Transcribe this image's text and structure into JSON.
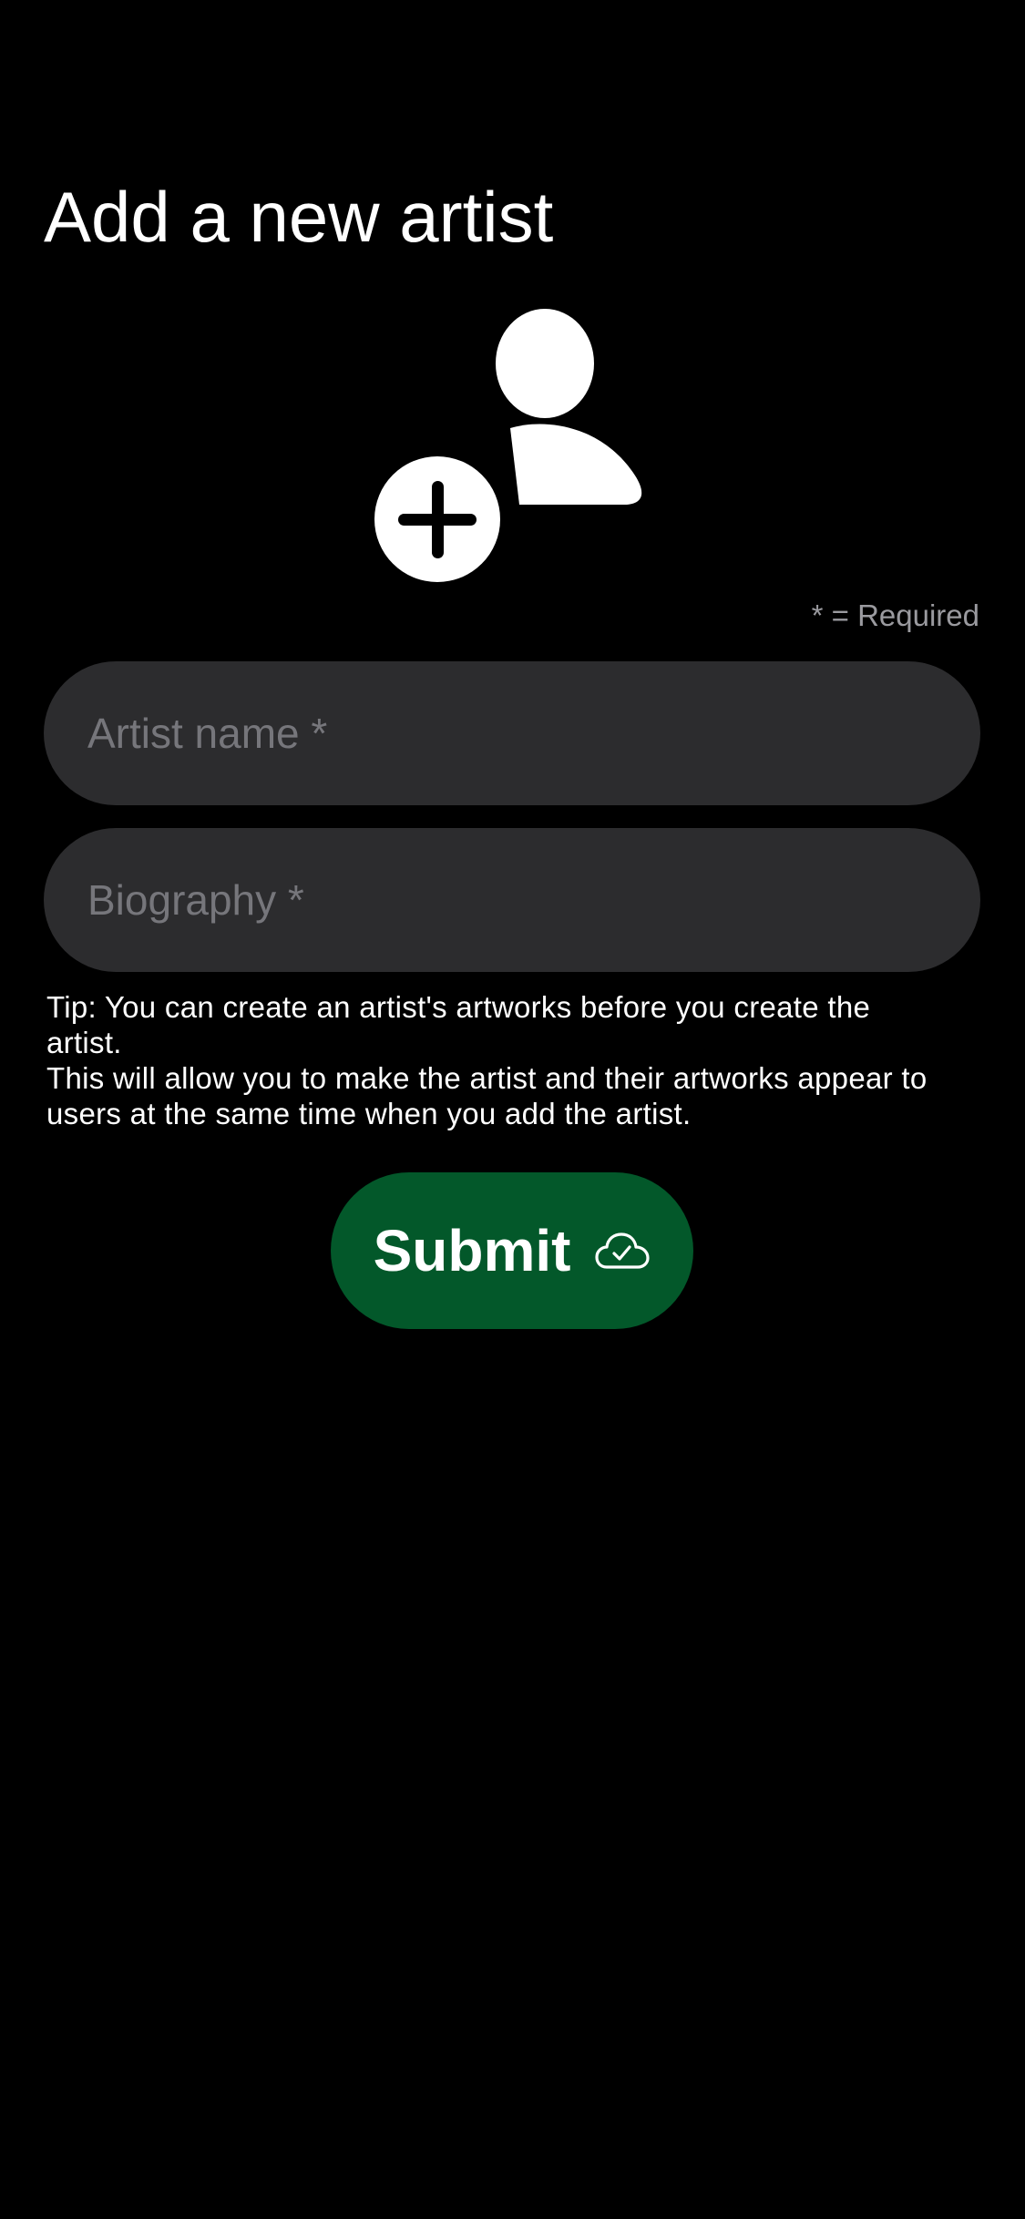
{
  "page": {
    "title": "Add a new artist",
    "required_note": "* = Required"
  },
  "form": {
    "artist_name_placeholder": "Artist name *",
    "biography_placeholder": "Biography *",
    "artist_name_value": "",
    "biography_value": ""
  },
  "tip": {
    "line1": "Tip: You can create an artist's artworks before you create the artist.",
    "line2": "This will allow you to make the artist and their artworks appear to users at the same time when you add the artist."
  },
  "submit": {
    "label": "Submit",
    "icon": "cloud-check-icon",
    "background": "#03582a"
  },
  "avatar": {
    "icon": "person-add-icon"
  },
  "colors": {
    "background": "#000000",
    "field_background": "#2c2c2e",
    "placeholder": "#76767b",
    "required_note": "#9a9a9f",
    "accent_green": "#03582a"
  }
}
